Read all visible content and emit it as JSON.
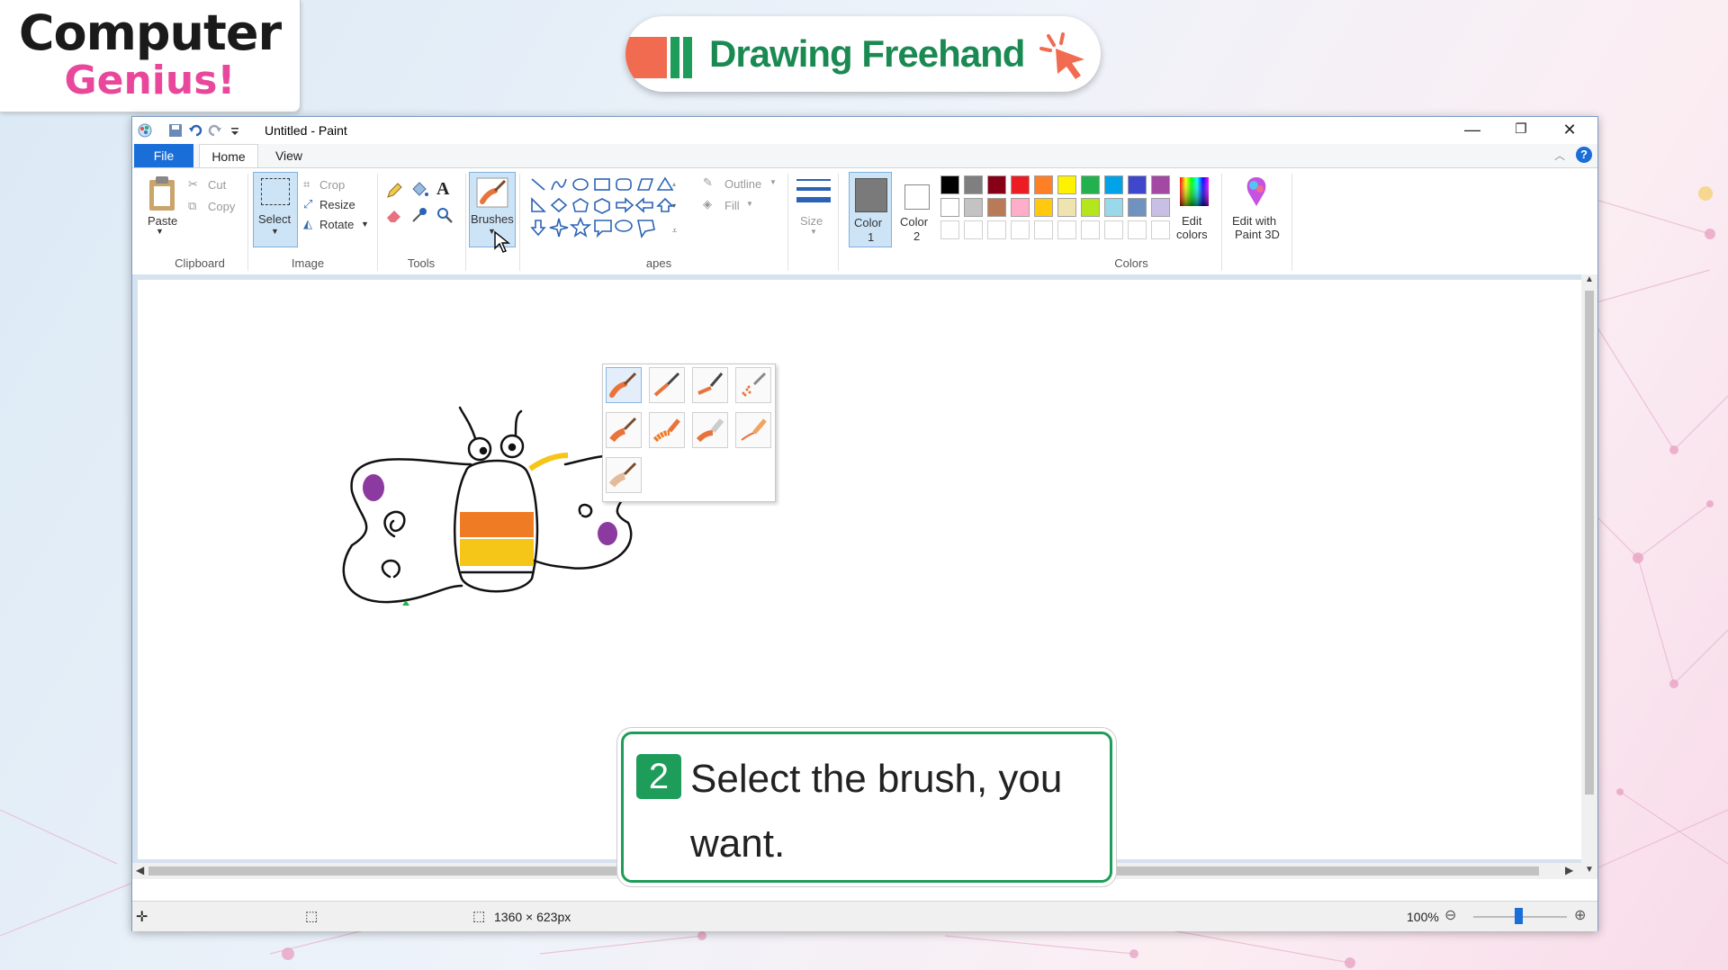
{
  "logo": {
    "line1": "Computer",
    "line2": "Genius!"
  },
  "header": {
    "title": "Drawing Freehand"
  },
  "window": {
    "title": "Untitled - Paint",
    "tabs": {
      "file": "File",
      "home": "Home",
      "view": "View"
    },
    "clipboard": {
      "paste": "Paste",
      "cut": "Cut",
      "copy": "Copy",
      "group": "Clipboard"
    },
    "image": {
      "select": "Select",
      "crop": "Crop",
      "resize": "Resize",
      "rotate": "Rotate",
      "group": "Image"
    },
    "tools": {
      "group": "Tools"
    },
    "brushes": {
      "label": "Brushes"
    },
    "shapes": {
      "outline": "Outline",
      "fill": "Fill",
      "group_partial": "apes"
    },
    "size": {
      "label": "Size"
    },
    "colors": {
      "color1_a": "Color",
      "color1_b": "1",
      "color2_a": "Color",
      "color2_b": "2",
      "edit_a": "Edit",
      "edit_b": "colors",
      "paint3d_a": "Edit with",
      "paint3d_b": "Paint 3D",
      "group": "Colors",
      "color1": "#7a7a7a",
      "color2": "#ffffff",
      "palette_row1": [
        "#000000",
        "#7f7f7f",
        "#880015",
        "#ed1c24",
        "#ff7f27",
        "#fff200",
        "#22b14c",
        "#00a2e8",
        "#3f48cc",
        "#a349a4"
      ],
      "palette_row2": [
        "#ffffff",
        "#c3c3c3",
        "#b97a57",
        "#ffaec9",
        "#ffc90e",
        "#efe4b0",
        "#b5e61d",
        "#99d9ea",
        "#7092be",
        "#c8bfe7"
      ]
    },
    "status": {
      "dimensions": "1360 × 623px",
      "zoom": "100%"
    }
  },
  "callout": {
    "number": "2",
    "text": "Select the brush, you want."
  }
}
